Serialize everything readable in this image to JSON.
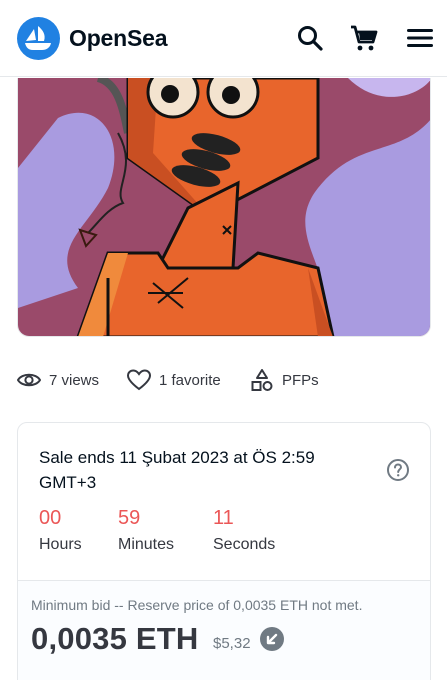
{
  "header": {
    "brand": "OpenSea",
    "icons": [
      "opensea-logo-icon",
      "search-icon",
      "cart-icon",
      "hamburger-menu-icon"
    ]
  },
  "stats": {
    "views": "7 views",
    "favorites": "1 favorite",
    "category": "PFPs"
  },
  "sale": {
    "ends_text": "Sale ends 11 Şubat 2023 at ÖS 2:59 GMT+3",
    "timer": [
      {
        "value": "00",
        "label": "Hours"
      },
      {
        "value": "59",
        "label": "Minutes"
      },
      {
        "value": "11",
        "label": "Seconds"
      }
    ],
    "bid_note": "Minimum bid -- Reserve price of 0,0035 ETH not met.",
    "price": "0,0035 ETH",
    "usd_price": "$5,32"
  },
  "colors": {
    "brand_blue": "#2081e2",
    "timer_red": "#eb5757",
    "text_dark": "#04111d",
    "text_muted": "#707a83"
  }
}
